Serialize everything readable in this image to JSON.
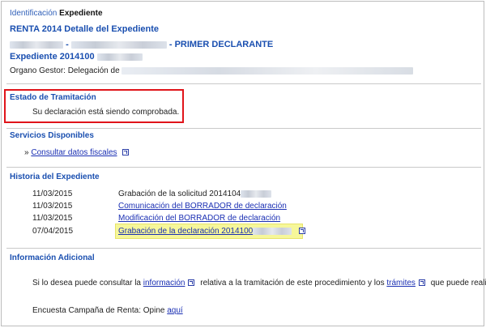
{
  "breadcrumb": {
    "link": "Identificación",
    "current": "Expediente"
  },
  "header": {
    "title": "RENTA 2014 Detalle del Expediente",
    "declarant_separator": "-",
    "declarant_role": "- PRIMER DECLARANTE",
    "expediente_prefix": "Expediente 2014100",
    "organo_label": "Organo Gestor: Delegación de"
  },
  "estado": {
    "title": "Estado de Tramitación",
    "text": "Su declaración está siendo comprobada."
  },
  "servicios": {
    "title": "Servicios Disponibles",
    "bullet": "»",
    "link": "Consultar datos fiscales"
  },
  "historia": {
    "title": "Historia del Expediente",
    "rows": [
      {
        "date": "11/03/2015",
        "text": "Grabación de la solicitud 2014104",
        "link": false
      },
      {
        "date": "11/03/2015",
        "text": "Comunicación del BORRADOR de declaración",
        "link": true
      },
      {
        "date": "11/03/2015",
        "text": "Modificación del BORRADOR de declaración",
        "link": true
      },
      {
        "date": "07/04/2015",
        "text": "Grabación de la declaración 2014100",
        "link": true
      }
    ]
  },
  "info": {
    "title": "Información Adicional",
    "line_before": "Si lo desea puede consultar la",
    "link_informacion": "información",
    "line_middle": "relativa a la tramitación de este procedimiento y los",
    "link_tramites": "trámites",
    "line_after": "que puede realizar.",
    "encuesta_text": "Encuesta Campaña de Renta: Opine",
    "encuesta_link": "aquí"
  },
  "colors": {
    "accent": "#1a4fb0",
    "link": "#1a2fb3",
    "status_border": "#e0141a",
    "highlight": "#f6f79a"
  }
}
